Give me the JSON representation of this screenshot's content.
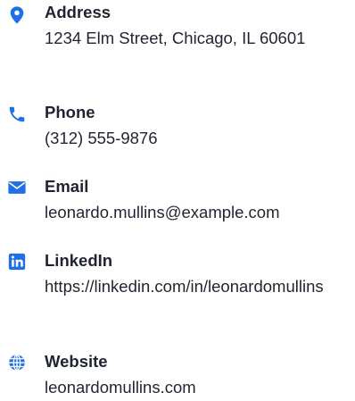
{
  "accent_color": "#1f6fe5",
  "contacts": [
    {
      "icon": "map-pin-icon",
      "label": "Address",
      "value": "1234 Elm Street, Chicago, IL 60601"
    },
    {
      "icon": "phone-icon",
      "label": "Phone",
      "value": "(312) 555-9876"
    },
    {
      "icon": "envelope-icon",
      "label": "Email",
      "value": "leonardo.mullins@example.com"
    },
    {
      "icon": "linkedin-icon",
      "label": "LinkedIn",
      "value": "https://linkedin.com/in/leonardomullins"
    },
    {
      "icon": "globe-icon",
      "label": "Website",
      "value": "leonardomullins.com"
    }
  ]
}
